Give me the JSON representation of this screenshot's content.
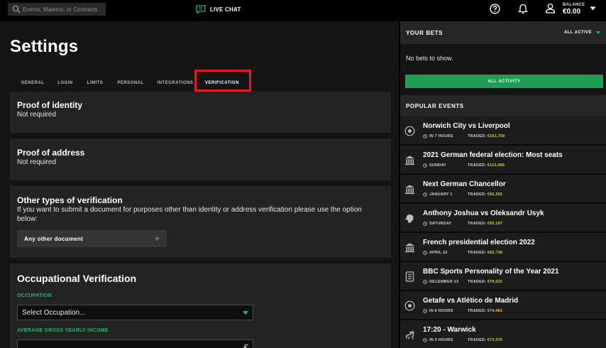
{
  "header": {
    "search_placeholder": "Events, Markets, or Contracts",
    "live_chat": "LIVE CHAT",
    "balance_label": "BALANCE",
    "balance_value": "€0.00"
  },
  "page": {
    "title": "Settings",
    "tabs": [
      "GENERAL",
      "LOGIN",
      "LIMITS",
      "PERSONAL",
      "INTEGRATIONS",
      "VERIFICATION"
    ],
    "active_tab": "VERIFICATION"
  },
  "verification": {
    "identity": {
      "title": "Proof of identity",
      "status": "Not required"
    },
    "address": {
      "title": "Proof of address",
      "status": "Not required"
    },
    "other": {
      "title": "Other types of verification",
      "description": "If you want to submit a document for purposes other than identity or address verification please use the option below:",
      "button": "Any other document",
      "plus": "+"
    },
    "occupational": {
      "title": "Occupational Verification",
      "occupation_label": "OCCUPATION",
      "occupation_value": "Select Occupation...",
      "income_label": "AVERAGE GROSS YEARLY INCOME",
      "currency_symbol": "€"
    }
  },
  "sidebar": {
    "your_bets": "YOUR BETS",
    "filter": "ALL ACTIVE",
    "no_bets": "No bets to show.",
    "all_activity": "ALL ACTIVITY",
    "popular_events": "POPULAR EVENTS",
    "traded_label": "TRADED:",
    "events": [
      {
        "name": "Norwich City vs Liverpool",
        "time": "IN 7 HOURS",
        "traded": "€161,769",
        "icon": "soccer-ball-icon"
      },
      {
        "name": "2021 German federal election: Most seats",
        "time": "SUNDAY",
        "traded": "€113,085",
        "icon": "government-building-icon"
      },
      {
        "name": "Next German Chancellor",
        "time": "JANUARY 1",
        "traded": "€92,392",
        "icon": "government-building-icon"
      },
      {
        "name": "Anthony Joshua vs Oleksandr Usyk",
        "time": "SATURDAY",
        "traded": "€92,197",
        "icon": "boxing-glove-icon"
      },
      {
        "name": "French presidential election 2022",
        "time": "APRIL 22",
        "traded": "€82,738",
        "icon": "government-building-icon"
      },
      {
        "name": "BBC Sports Personality of the Year 2021",
        "time": "DECEMBER 13",
        "traded": "€79,632",
        "icon": "tv-icon"
      },
      {
        "name": "Getafe vs Atlético de Madrid",
        "time": "IN 6 HOURS",
        "traded": "€74,481",
        "icon": "soccer-ball-icon"
      },
      {
        "name": "17:20 - Warwick",
        "time": "IN 3 HOURS",
        "traded": "€73,375",
        "icon": "horse-racing-icon"
      }
    ]
  },
  "colors": {
    "accent": "#1f9d55",
    "highlight": "#e01b24",
    "amount": "#e6c63a"
  }
}
